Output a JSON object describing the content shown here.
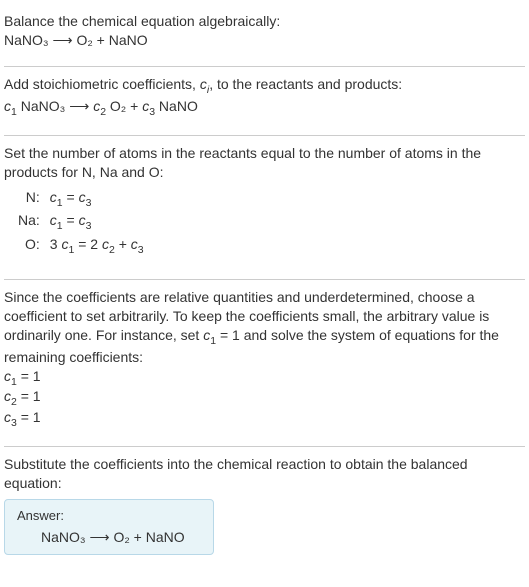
{
  "sections": {
    "s1_line1": "Balance the chemical equation algebraically:",
    "s1_eq": "NaNO₃ ⟶ O₂ + NaNO",
    "s2_line1_a": "Add stoichiometric coefficients, ",
    "s2_line1_ci": "c",
    "s2_line1_ci_sub": "i",
    "s2_line1_b": ", to the reactants and products:",
    "s2_eq_c1": "c",
    "s2_eq_c1_sub": "1",
    "s2_eq_sp1": " NaNO₃ ⟶ ",
    "s2_eq_c2": "c",
    "s2_eq_c2_sub": "2",
    "s2_eq_sp2": " O₂ + ",
    "s2_eq_c3": "c",
    "s2_eq_c3_sub": "3",
    "s2_eq_sp3": " NaNO",
    "s3_line1": "Set the number of atoms in the reactants equal to the number of atoms in the products for N, Na and O:",
    "atom_rows": {
      "n_label": "N:",
      "n_eq_a": "c",
      "n_eq_a_sub": "1",
      "n_eq_mid": " = ",
      "n_eq_b": "c",
      "n_eq_b_sub": "3",
      "na_label": "Na:",
      "na_eq_a": "c",
      "na_eq_a_sub": "1",
      "na_eq_mid": " = ",
      "na_eq_b": "c",
      "na_eq_b_sub": "3",
      "o_label": "O:",
      "o_eq_pre": "3 ",
      "o_eq_a": "c",
      "o_eq_a_sub": "1",
      "o_eq_mid": " = 2 ",
      "o_eq_b": "c",
      "o_eq_b_sub": "2",
      "o_eq_mid2": " + ",
      "o_eq_c": "c",
      "o_eq_c_sub": "3"
    },
    "s4_line1_a": "Since the coefficients are relative quantities and underdetermined, choose a coefficient to set arbitrarily. To keep the coefficients small, the arbitrary value is ordinarily one. For instance, set ",
    "s4_line1_c": "c",
    "s4_line1_c_sub": "1",
    "s4_line1_b": " = 1 and solve the system of equations for the remaining coefficients:",
    "coef_solutions": {
      "c1_a": "c",
      "c1_sub": "1",
      "c1_val": " = 1",
      "c2_a": "c",
      "c2_sub": "2",
      "c2_val": " = 1",
      "c3_a": "c",
      "c3_sub": "3",
      "c3_val": " = 1"
    },
    "s5_line1": "Substitute the coefficients into the chemical reaction to obtain the balanced equation:",
    "answer_label": "Answer:",
    "answer_eq": "NaNO₃ ⟶ O₂ + NaNO"
  }
}
